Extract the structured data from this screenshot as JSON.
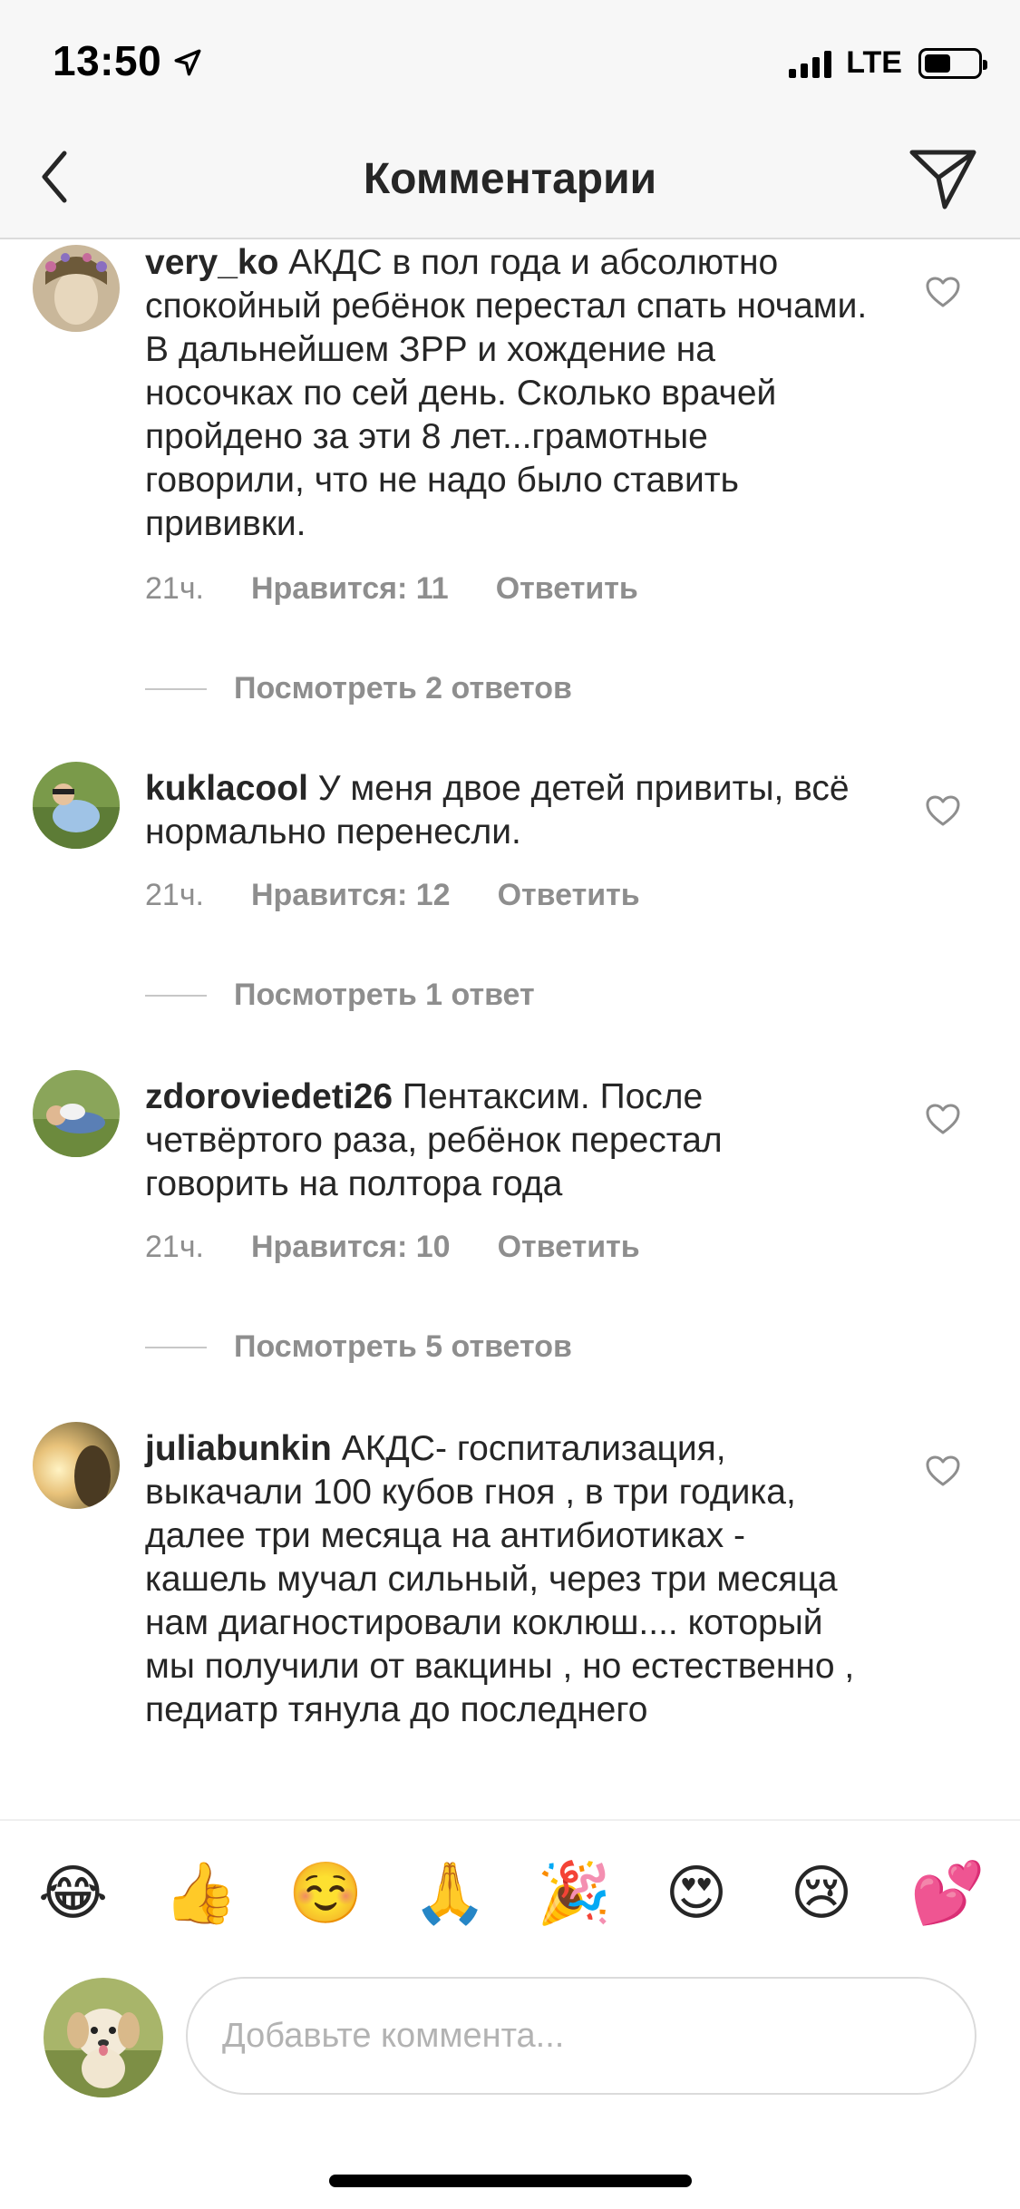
{
  "status_bar": {
    "time": "13:50",
    "network": "LTE"
  },
  "header": {
    "title": "Комментарии"
  },
  "comments": [
    {
      "username": "very_ko",
      "text": "АКДС в пол года и абсолютно спокойный ребёнок перестал спать ночами. В дальнейшем ЗРР и хождение на носочках по сей день. Сколько врачей пройдено за эти 8 лет...грамотные говорили, что не надо было ставить прививки.",
      "time": "21ч.",
      "likes": "Нравится: 11",
      "reply": "Ответить",
      "view_replies": "Посмотреть 2 ответов"
    },
    {
      "username": "kuklacool",
      "text": "У меня двое детей привиты, всё нормально перенесли.",
      "time": "21ч.",
      "likes": "Нравится: 12",
      "reply": "Ответить",
      "view_replies": "Посмотреть 1 ответ"
    },
    {
      "username": "zdoroviedeti26",
      "text": "Пентаксим. После четвёртого раза, ребёнок перестал говорить на полтора года",
      "time": "21ч.",
      "likes": "Нравится: 10",
      "reply": "Ответить",
      "view_replies": "Посмотреть 5 ответов"
    },
    {
      "username": "juliabunkin",
      "text": "АКДС- госпитализация, выкачали 100 кубов гноя , в три годика, далее три месяца на антибиотиках - кашель мучал сильный, через три месяца нам диагностировали коклюш.... который мы получили от вакцины , но естественно , педиатр тянула  до последнего"
    }
  ],
  "reactions": [
    "😂",
    "👍",
    "☺️",
    "🙏",
    "🎉",
    "😍",
    "😢",
    "💕"
  ],
  "composer": {
    "placeholder": "Добавьте коммента..."
  }
}
